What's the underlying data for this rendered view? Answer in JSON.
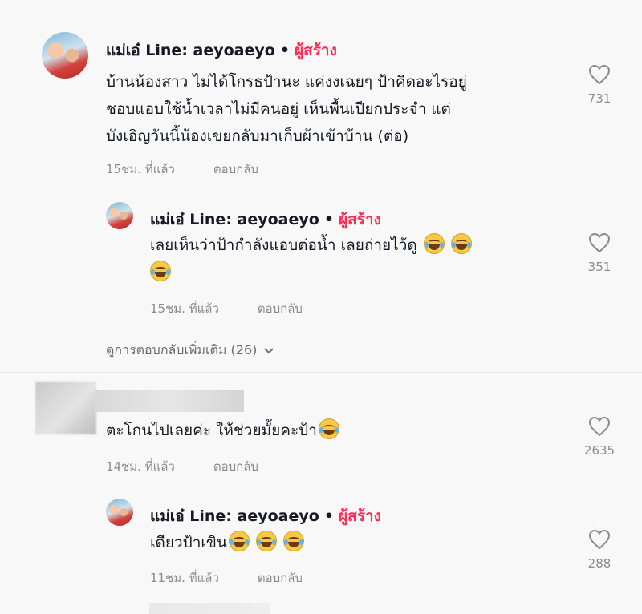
{
  "comments": [
    {
      "username": "แม่เอ๋ Line: aeyoaeyo",
      "separator": "•",
      "creator_badge": "ผู้สร้าง",
      "text_lines": [
        "บ้านน้องสาว ไม่ได้โกรธป้านะ แค่งงเฉยๆ ป้าคิดอะไรอยู่",
        "ชอบแอบใช้น้ำเวลาไม่มีคนอยู่ เห็นพื้นเปียกประจำ แต่",
        "บังเอิญวันนี้น้องเขยกลับมาเก็บผ้าเข้าบ้าน (ต่อ)"
      ],
      "time": "15ชม. ที่แล้ว",
      "reply_label": "ตอบกลับ",
      "likes": "731"
    },
    {
      "username": "แม่เอ๋ Line: aeyoaeyo",
      "separator": "•",
      "creator_badge": "ผู้สร้าง",
      "text_line1": "เลยเห็นว่าป้ากำลังแอบต่อน้ำ เลยถ่ายไว้ดู",
      "time": "15ชม. ที่แล้ว",
      "reply_label": "ตอบกลับ",
      "likes": "351"
    },
    {
      "text": "ตะโกนไปเลยค่ะ ให้ช่วยมั้ยคะป้า",
      "time": "14ชม. ที่แล้ว",
      "reply_label": "ตอบกลับ",
      "likes": "2635"
    },
    {
      "username": "แม่เอ๋ Line: aeyoaeyo",
      "separator": "•",
      "creator_badge": "ผู้สร้าง",
      "text": "เดียวป้าเขิน",
      "time": "11ชม. ที่แล้ว",
      "reply_label": "ตอบกลับ",
      "likes": "288"
    }
  ],
  "more_replies": "ดูการตอบกลับเพิ่มเติม (26)",
  "icons": {
    "like": "heart-outline-icon",
    "expand": "chevron-down-icon",
    "emoji": "tears-of-joy-emoji"
  },
  "colors": {
    "creator": "#fe2c55",
    "muted": "#8a8b91",
    "text": "#161823"
  }
}
